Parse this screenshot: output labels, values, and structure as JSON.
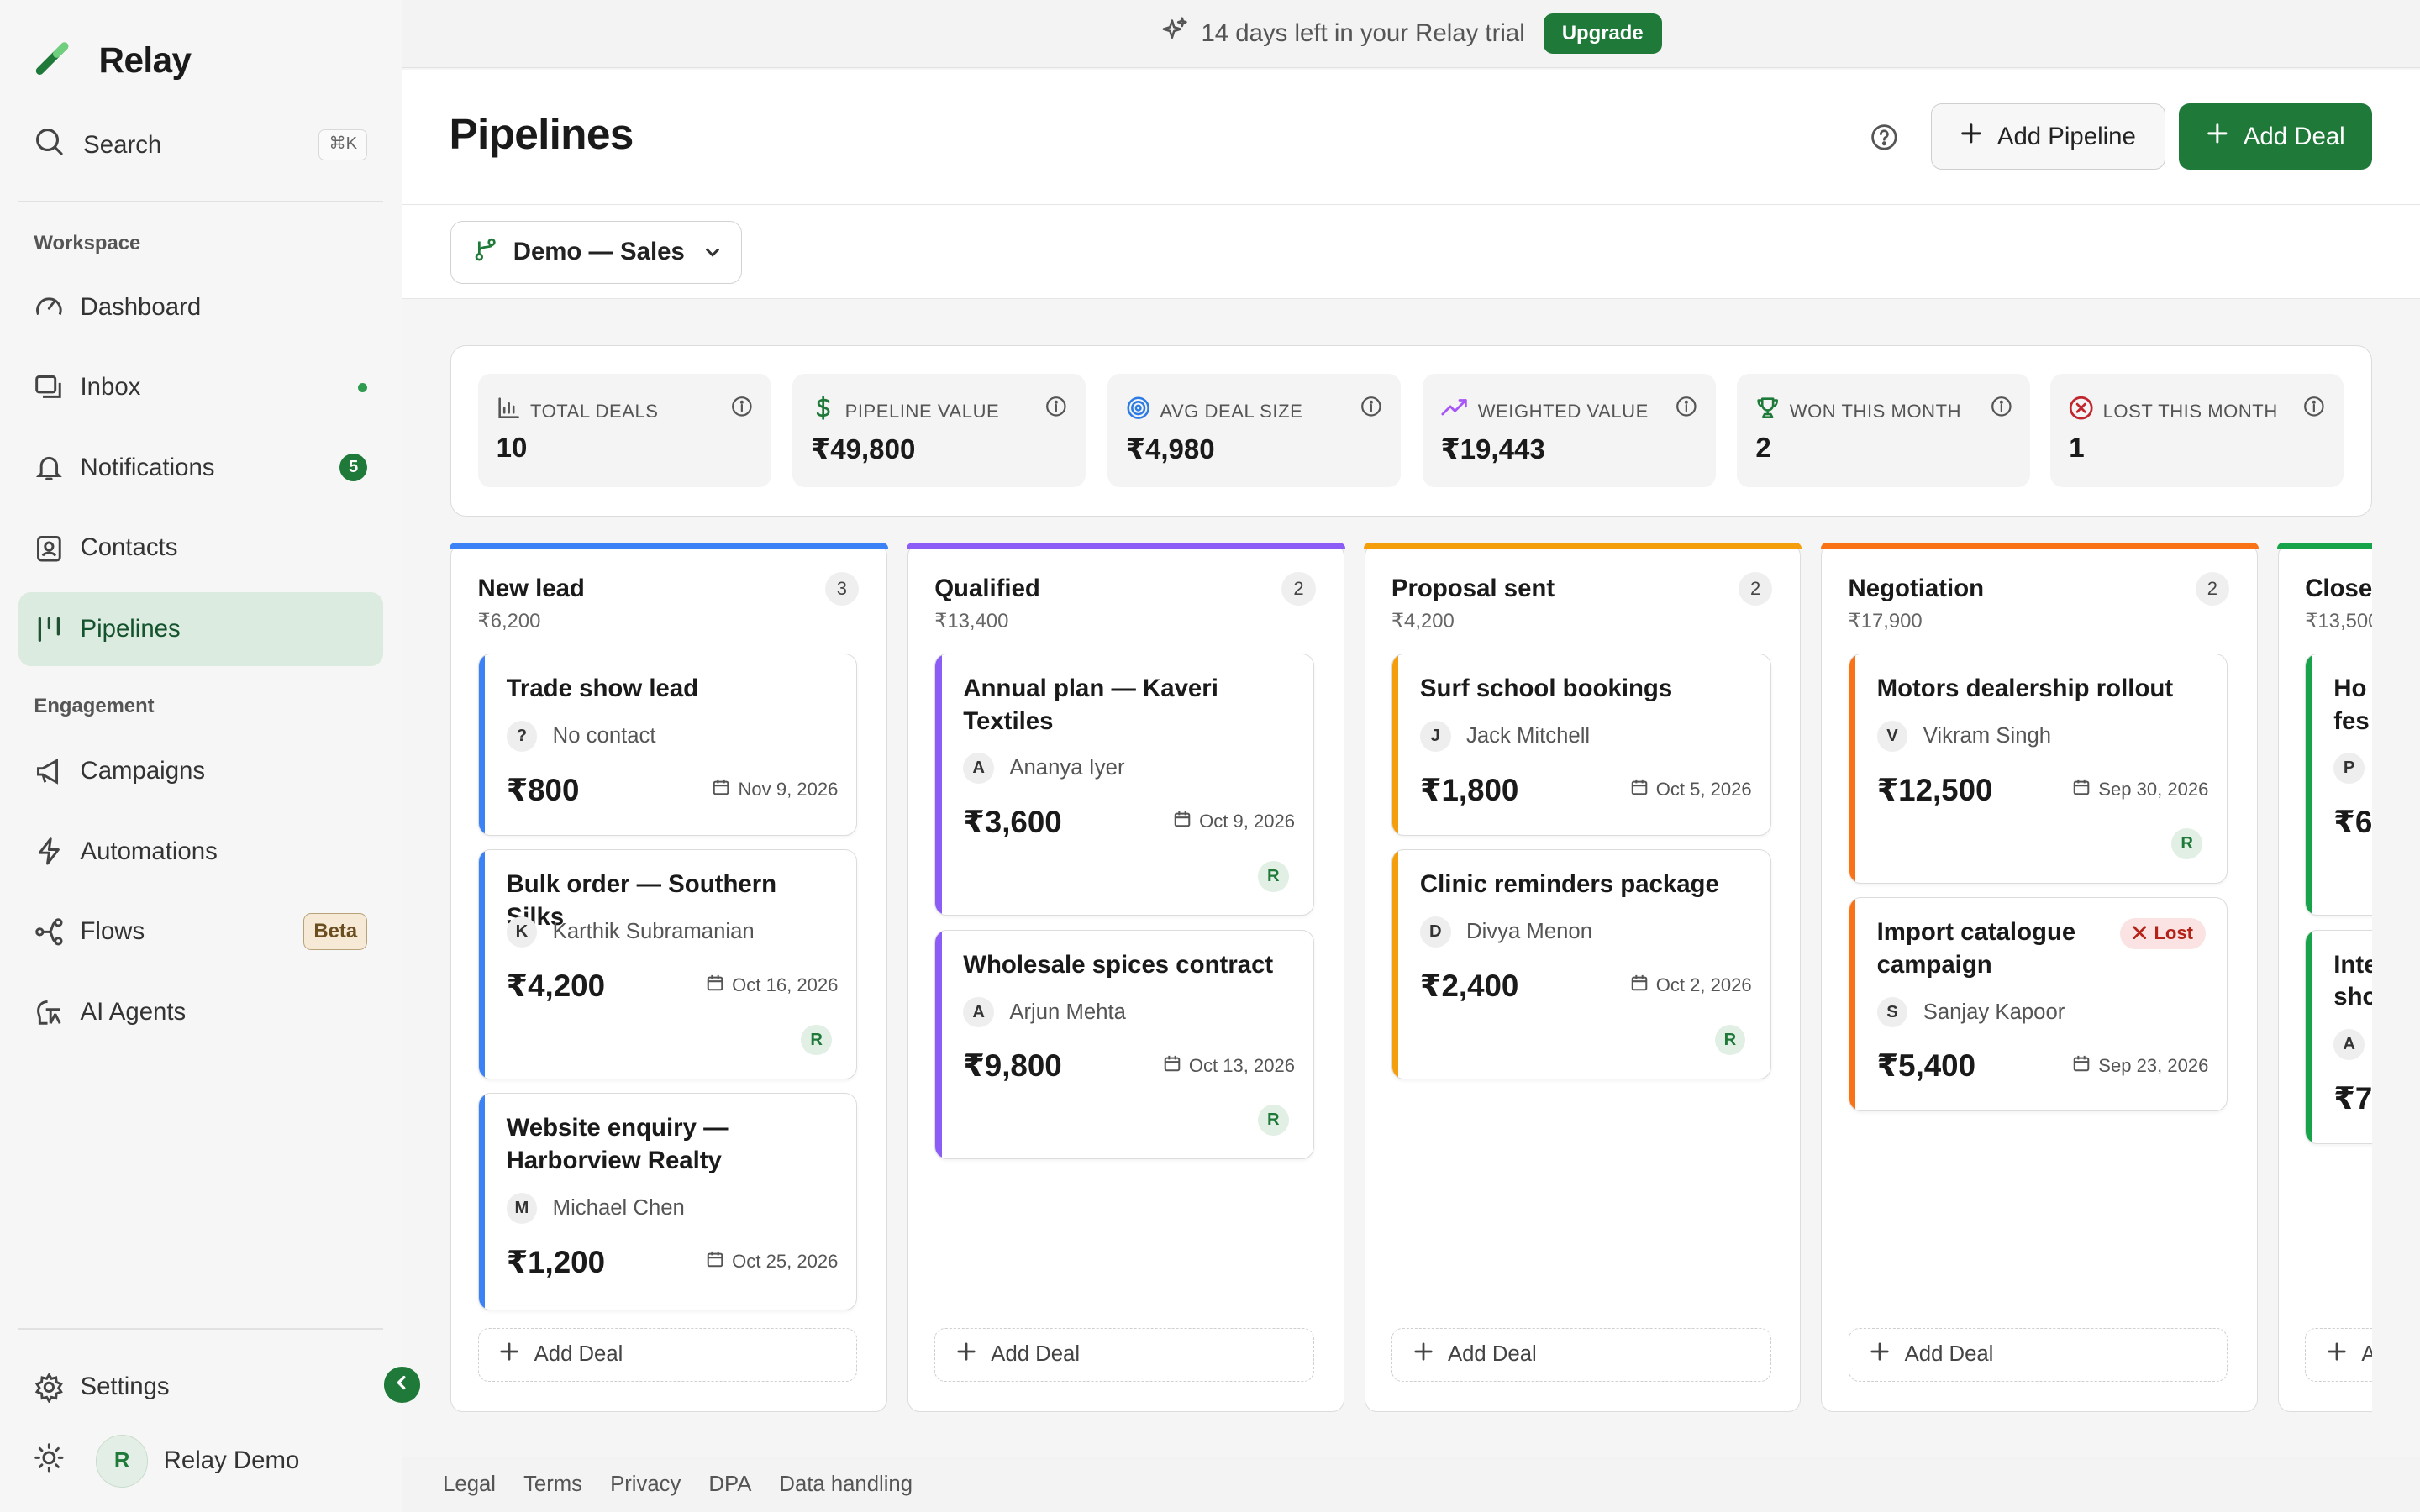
{
  "brand": {
    "name": "Relay"
  },
  "search": {
    "label": "Search",
    "shortcut": "⌘K"
  },
  "sidebar": {
    "workspace_label": "Workspace",
    "engagement_label": "Engagement",
    "items": [
      {
        "label": "Dashboard",
        "icon": "gauge-icon"
      },
      {
        "label": "Inbox",
        "icon": "inbox-icon",
        "unread_dot": true
      },
      {
        "label": "Notifications",
        "icon": "bell-icon",
        "badge": "5"
      },
      {
        "label": "Contacts",
        "icon": "contact-card-icon"
      },
      {
        "label": "Pipelines",
        "icon": "pipeline-icon",
        "active": true
      },
      {
        "label": "Campaigns",
        "icon": "megaphone-icon"
      },
      {
        "label": "Automations",
        "icon": "lightning-icon"
      },
      {
        "label": "Flows",
        "icon": "flow-icon",
        "badge": "Beta"
      },
      {
        "label": "AI Agents",
        "icon": "ai-agent-icon"
      }
    ],
    "settings_label": "Settings",
    "user": {
      "initial": "R",
      "name": "Relay Demo"
    }
  },
  "trial": {
    "message": "14 days left in your Relay trial",
    "button": "Upgrade"
  },
  "header": {
    "title": "Pipelines",
    "add_pipeline": "Add Pipeline",
    "add_deal": "Add Deal"
  },
  "pipeline_select": {
    "value": "Demo — Sales"
  },
  "stats": [
    {
      "label": "TOTAL DEALS",
      "value": "10",
      "icon": "bar-chart-icon"
    },
    {
      "label": "PIPELINE VALUE",
      "value": "₹49,800",
      "icon": "dollar-icon"
    },
    {
      "label": "AVG DEAL SIZE",
      "value": "₹4,980",
      "icon": "target-icon"
    },
    {
      "label": "WEIGHTED VALUE",
      "value": "₹19,443",
      "icon": "trend-up-icon"
    },
    {
      "label": "WON THIS MONTH",
      "value": "2",
      "icon": "trophy-icon"
    },
    {
      "label": "LOST THIS MONTH",
      "value": "1",
      "icon": "x-circle-icon"
    }
  ],
  "columns": [
    {
      "title": "New lead",
      "total": "₹6,200",
      "count": "3",
      "color": "#3b82f6",
      "cards": [
        {
          "title": "Trade show lead",
          "initial": "?",
          "contact": "No contact",
          "amount": "₹800",
          "date": "Nov 9, 2026"
        },
        {
          "title": "Bulk order — Southern Silks",
          "initial": "K",
          "contact": "Karthik Subramanian",
          "amount": "₹4,200",
          "date": "Oct 16, 2026",
          "owner": "R"
        },
        {
          "title": "Website enquiry — Harborview Realty",
          "initial": "M",
          "contact": "Michael Chen",
          "amount": "₹1,200",
          "date": "Oct 25, 2026"
        }
      ],
      "add_label": "Add Deal"
    },
    {
      "title": "Qualified",
      "total": "₹13,400",
      "count": "2",
      "color": "#8b5cf6",
      "cards": [
        {
          "title": "Annual plan — Kaveri Textiles",
          "initial": "A",
          "contact": "Ananya Iyer",
          "amount": "₹3,600",
          "date": "Oct 9, 2026",
          "owner": "R"
        },
        {
          "title": "Wholesale spices contract",
          "initial": "A",
          "contact": "Arjun Mehta",
          "amount": "₹9,800",
          "date": "Oct 13, 2026",
          "owner": "R"
        }
      ],
      "add_label": "Add Deal"
    },
    {
      "title": "Proposal sent",
      "total": "₹4,200",
      "count": "2",
      "color": "#f59e0b",
      "cards": [
        {
          "title": "Surf school bookings",
          "initial": "J",
          "contact": "Jack Mitchell",
          "amount": "₹1,800",
          "date": "Oct 5, 2026"
        },
        {
          "title": "Clinic reminders package",
          "initial": "D",
          "contact": "Divya Menon",
          "amount": "₹2,400",
          "date": "Oct 2, 2026",
          "owner": "R"
        }
      ],
      "add_label": "Add Deal"
    },
    {
      "title": "Negotiation",
      "total": "₹17,900",
      "count": "2",
      "color": "#f97316",
      "cards": [
        {
          "title": "Motors dealership rollout",
          "initial": "V",
          "contact": "Vikram Singh",
          "amount": "₹12,500",
          "date": "Sep 30, 2026",
          "owner": "R"
        },
        {
          "title": "Import catalogue campaign",
          "initial": "S",
          "contact": "Sanjay Kapoor",
          "amount": "₹5,400",
          "date": "Sep 23, 2026",
          "badge": "Lost"
        }
      ],
      "add_label": "Add Deal"
    },
    {
      "title": "Close",
      "total": "₹13,500",
      "count": "",
      "color": "#16a34a",
      "cards": [
        {
          "title": "Ho fes",
          "initial": "P",
          "contact": "",
          "amount": "₹6"
        },
        {
          "title": "Inte sho",
          "initial": "A",
          "contact": "",
          "amount": "₹7,"
        }
      ],
      "add_label": "A"
    }
  ],
  "footer": {
    "links": [
      "Legal",
      "Terms",
      "Privacy",
      "DPA",
      "Data handling"
    ]
  },
  "colors": {
    "brand": "#1f7a3a",
    "active_nav_bg": "#dcebe0",
    "lost": "#b42318"
  }
}
